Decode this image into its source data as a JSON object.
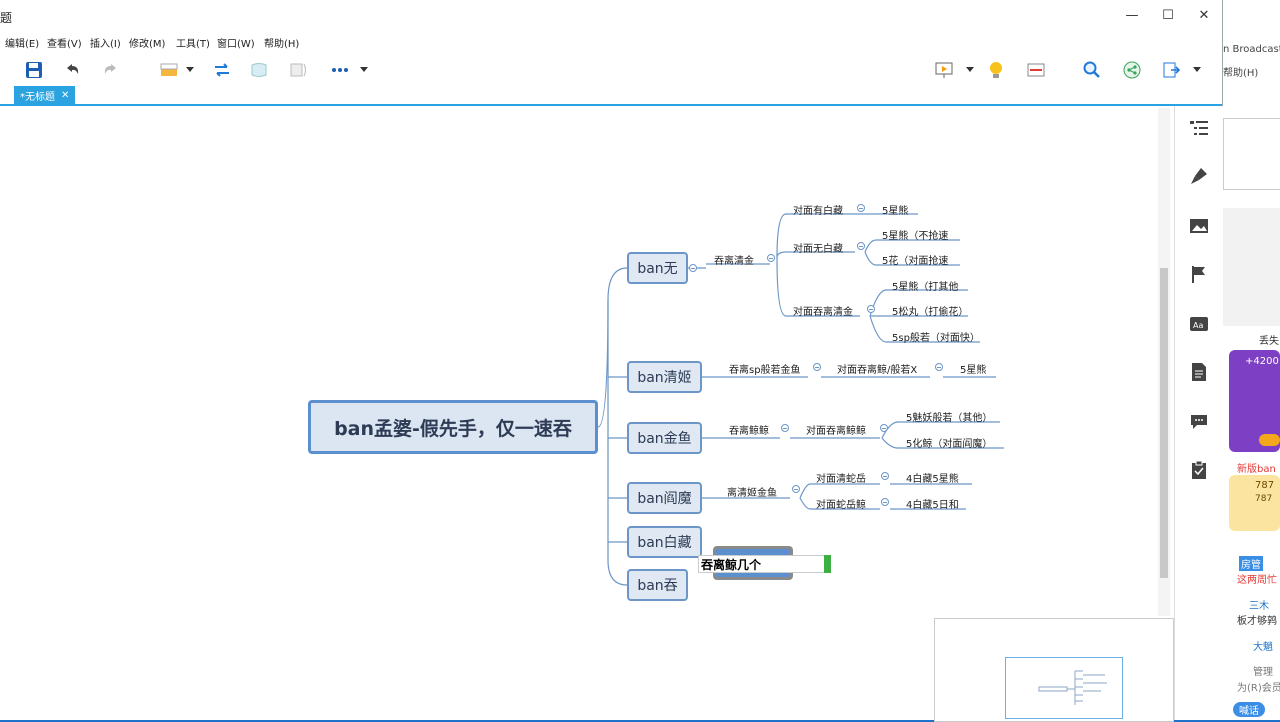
{
  "window": {
    "title": "题",
    "min": "—",
    "max": "☐",
    "close": "✕"
  },
  "menu": [
    "编辑(E)",
    "查看(V)",
    "插入(I)",
    "修改(M)",
    "工具(T)",
    "窗口(W)",
    "帮助(H)"
  ],
  "tab": {
    "label": "*无标题",
    "close": "✕"
  },
  "mindmap": {
    "root": "ban孟婆-假先手，仅一速吞",
    "b1": {
      "label": "ban无",
      "sub": "吞离清金",
      "c1": "对面有白藏",
      "c1a": "5星熊",
      "c2": "对面无白藏",
      "c2a": "5星熊（不抢速",
      "c2b": "5花（对面抢速",
      "c3": "对面吞离清金",
      "c3a": "5星熊（打其他",
      "c3b": "5松丸（打偷花）",
      "c3c": "5sp般若（对面快）"
    },
    "b2": {
      "label": "ban清姬",
      "sub": "吞离sp般若金鱼",
      "c1": "对面吞离鲸/般若X",
      "c1a": "5星熊"
    },
    "b3": {
      "label": "ban金鱼",
      "sub": "吞离鲸鲸",
      "c1": "对面吞离鲸鲸",
      "c1a": "5魅妖般若（其他）",
      "c1b": "5化鲸（对面阎魔）"
    },
    "b4": {
      "label": "ban阎魔",
      "sub": "离清姬金鱼",
      "c1": "对面清蛇岳",
      "c1a": "4白藏5星熊",
      "c2": "对面蛇岳鲸",
      "c2a": "4白藏5日和"
    },
    "b5": {
      "label": "ban白藏"
    },
    "b6": {
      "label": "ban吞"
    },
    "editing": "吞离鲸几个"
  },
  "side": {
    "broadcast": "n Broadcaste",
    "help": "帮助(H)",
    "lost": "丢失",
    "count": "+4200",
    "news": "新版ban",
    "num1": "787",
    "num2": "787",
    "room": "房管",
    "week": "这两周忙",
    "user": "三木",
    "msg": "板才够鹑",
    "big": "大魈",
    "admin": "管理",
    "notice": "为(R)会员",
    "chat": "喊话"
  },
  "colors": {
    "accent": "#2aa3e0",
    "node_border": "#6c96c8",
    "node_fill": "#dfe8f3",
    "root_border": "#5b8fd0"
  }
}
